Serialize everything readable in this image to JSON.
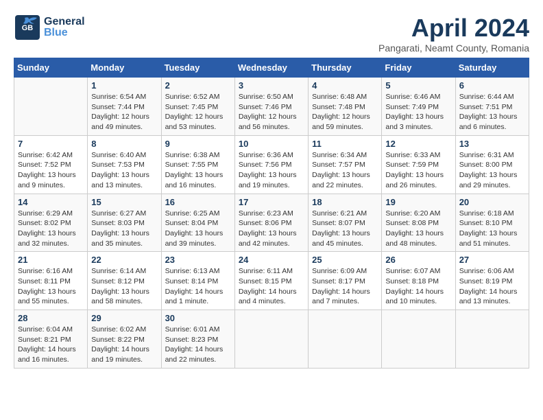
{
  "header": {
    "logo_general": "General",
    "logo_blue": "Blue",
    "month_title": "April 2024",
    "subtitle": "Pangarati, Neamt County, Romania"
  },
  "days_of_week": [
    "Sunday",
    "Monday",
    "Tuesday",
    "Wednesday",
    "Thursday",
    "Friday",
    "Saturday"
  ],
  "weeks": [
    [
      {
        "day": "",
        "info": ""
      },
      {
        "day": "1",
        "info": "Sunrise: 6:54 AM\nSunset: 7:44 PM\nDaylight: 12 hours\nand 49 minutes."
      },
      {
        "day": "2",
        "info": "Sunrise: 6:52 AM\nSunset: 7:45 PM\nDaylight: 12 hours\nand 53 minutes."
      },
      {
        "day": "3",
        "info": "Sunrise: 6:50 AM\nSunset: 7:46 PM\nDaylight: 12 hours\nand 56 minutes."
      },
      {
        "day": "4",
        "info": "Sunrise: 6:48 AM\nSunset: 7:48 PM\nDaylight: 12 hours\nand 59 minutes."
      },
      {
        "day": "5",
        "info": "Sunrise: 6:46 AM\nSunset: 7:49 PM\nDaylight: 13 hours\nand 3 minutes."
      },
      {
        "day": "6",
        "info": "Sunrise: 6:44 AM\nSunset: 7:51 PM\nDaylight: 13 hours\nand 6 minutes."
      }
    ],
    [
      {
        "day": "7",
        "info": "Sunrise: 6:42 AM\nSunset: 7:52 PM\nDaylight: 13 hours\nand 9 minutes."
      },
      {
        "day": "8",
        "info": "Sunrise: 6:40 AM\nSunset: 7:53 PM\nDaylight: 13 hours\nand 13 minutes."
      },
      {
        "day": "9",
        "info": "Sunrise: 6:38 AM\nSunset: 7:55 PM\nDaylight: 13 hours\nand 16 minutes."
      },
      {
        "day": "10",
        "info": "Sunrise: 6:36 AM\nSunset: 7:56 PM\nDaylight: 13 hours\nand 19 minutes."
      },
      {
        "day": "11",
        "info": "Sunrise: 6:34 AM\nSunset: 7:57 PM\nDaylight: 13 hours\nand 22 minutes."
      },
      {
        "day": "12",
        "info": "Sunrise: 6:33 AM\nSunset: 7:59 PM\nDaylight: 13 hours\nand 26 minutes."
      },
      {
        "day": "13",
        "info": "Sunrise: 6:31 AM\nSunset: 8:00 PM\nDaylight: 13 hours\nand 29 minutes."
      }
    ],
    [
      {
        "day": "14",
        "info": "Sunrise: 6:29 AM\nSunset: 8:02 PM\nDaylight: 13 hours\nand 32 minutes."
      },
      {
        "day": "15",
        "info": "Sunrise: 6:27 AM\nSunset: 8:03 PM\nDaylight: 13 hours\nand 35 minutes."
      },
      {
        "day": "16",
        "info": "Sunrise: 6:25 AM\nSunset: 8:04 PM\nDaylight: 13 hours\nand 39 minutes."
      },
      {
        "day": "17",
        "info": "Sunrise: 6:23 AM\nSunset: 8:06 PM\nDaylight: 13 hours\nand 42 minutes."
      },
      {
        "day": "18",
        "info": "Sunrise: 6:21 AM\nSunset: 8:07 PM\nDaylight: 13 hours\nand 45 minutes."
      },
      {
        "day": "19",
        "info": "Sunrise: 6:20 AM\nSunset: 8:08 PM\nDaylight: 13 hours\nand 48 minutes."
      },
      {
        "day": "20",
        "info": "Sunrise: 6:18 AM\nSunset: 8:10 PM\nDaylight: 13 hours\nand 51 minutes."
      }
    ],
    [
      {
        "day": "21",
        "info": "Sunrise: 6:16 AM\nSunset: 8:11 PM\nDaylight: 13 hours\nand 55 minutes."
      },
      {
        "day": "22",
        "info": "Sunrise: 6:14 AM\nSunset: 8:12 PM\nDaylight: 13 hours\nand 58 minutes."
      },
      {
        "day": "23",
        "info": "Sunrise: 6:13 AM\nSunset: 8:14 PM\nDaylight: 14 hours\nand 1 minute."
      },
      {
        "day": "24",
        "info": "Sunrise: 6:11 AM\nSunset: 8:15 PM\nDaylight: 14 hours\nand 4 minutes."
      },
      {
        "day": "25",
        "info": "Sunrise: 6:09 AM\nSunset: 8:17 PM\nDaylight: 14 hours\nand 7 minutes."
      },
      {
        "day": "26",
        "info": "Sunrise: 6:07 AM\nSunset: 8:18 PM\nDaylight: 14 hours\nand 10 minutes."
      },
      {
        "day": "27",
        "info": "Sunrise: 6:06 AM\nSunset: 8:19 PM\nDaylight: 14 hours\nand 13 minutes."
      }
    ],
    [
      {
        "day": "28",
        "info": "Sunrise: 6:04 AM\nSunset: 8:21 PM\nDaylight: 14 hours\nand 16 minutes."
      },
      {
        "day": "29",
        "info": "Sunrise: 6:02 AM\nSunset: 8:22 PM\nDaylight: 14 hours\nand 19 minutes."
      },
      {
        "day": "30",
        "info": "Sunrise: 6:01 AM\nSunset: 8:23 PM\nDaylight: 14 hours\nand 22 minutes."
      },
      {
        "day": "",
        "info": ""
      },
      {
        "day": "",
        "info": ""
      },
      {
        "day": "",
        "info": ""
      },
      {
        "day": "",
        "info": ""
      }
    ]
  ]
}
